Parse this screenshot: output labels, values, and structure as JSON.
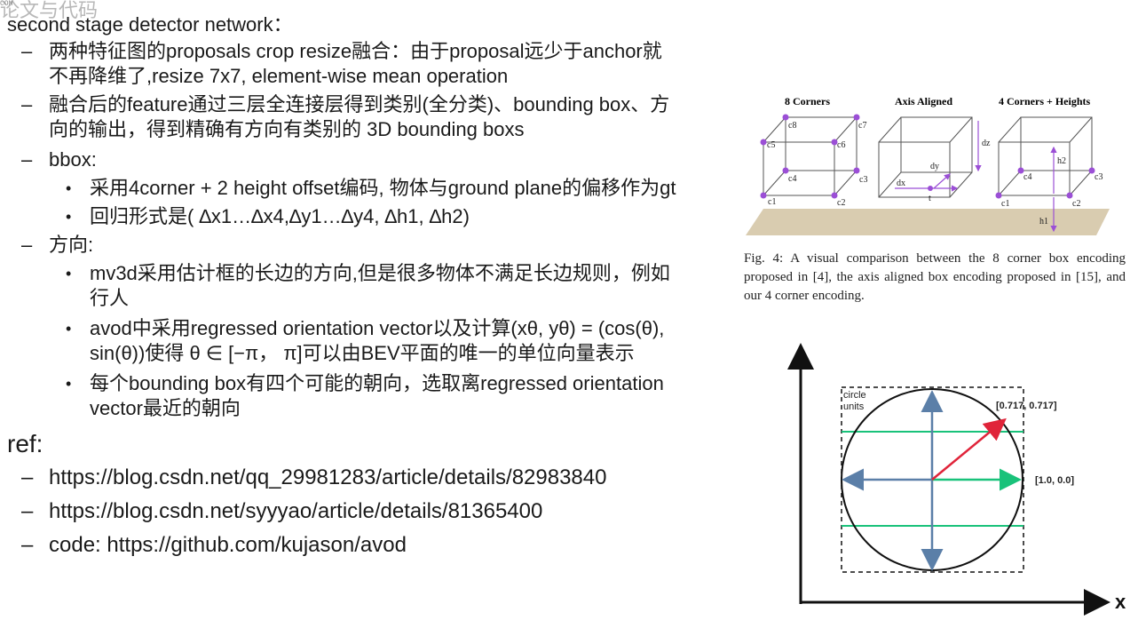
{
  "header": {
    "ghost_text": "论文与代码",
    "corner_mark": "COM",
    "title": "second stage detector network："
  },
  "bullets": [
    {
      "level": 1,
      "lines": [
        "两种特征图的proposals crop resize融合：由于proposal远少于anchor就",
        "不再降维了,resize 7x7, element-wise mean operation"
      ]
    },
    {
      "level": 1,
      "lines": [
        "融合后的feature通过三层全连接层得到类别(全分类)、bounding box、方",
        "向的输出，得到精确有方向有类别的 3D bounding boxs"
      ]
    },
    {
      "level": 1,
      "lines": [
        "bbox:"
      ]
    },
    {
      "level": 2,
      "lines": [
        "采用4corner + 2 height offset编码, 物体与ground plane的偏移作为gt"
      ]
    },
    {
      "level": 2,
      "lines": [
        "回归形式是( ∆x1…∆x4,∆y1…∆y4, ∆h1, ∆h2)"
      ]
    },
    {
      "level": 1,
      "lines": [
        "方向:"
      ]
    },
    {
      "level": 2,
      "lines": [
        "mv3d采用估计框的长边的方向,但是很多物体不满足长边规则，例如",
        "行人"
      ]
    },
    {
      "level": 2,
      "lines": [
        "avod中采用regressed orientation vector以及计算(xθ, yθ) = (cos(θ),",
        "sin(θ))使得 θ ∈ [−π，  π]可以由BEV平面的唯一的单位向量表示"
      ]
    },
    {
      "level": 2,
      "lines": [
        "每个bounding box有四个可能的朝向，选取离regressed orientation",
        "vector最近的朝向"
      ]
    }
  ],
  "ref": {
    "heading": "ref:",
    "items": [
      "https://blog.csdn.net/qq_29981283/article/details/82983840",
      "https://blog.csdn.net/syyyao/article/details/81365400",
      "code: https://github.com/kujason/avod"
    ]
  },
  "markers": {
    "dash": "–",
    "dot": "•"
  },
  "figure": {
    "panels": [
      "8 Corners",
      "Axis Aligned",
      "4 Corners + Heights"
    ],
    "corner_labels": {
      "c1": "c1",
      "c2": "c2",
      "c3": "c3",
      "c4": "c4",
      "c5": "c5",
      "c6": "c6",
      "c7": "c7",
      "c8": "c8"
    },
    "axis_labels": {
      "dz": "dz",
      "dy": "dy",
      "dx": "dx",
      "t": "t"
    },
    "height_labels": {
      "h1": "h1",
      "h2": "h2"
    },
    "caption": "Fig. 4: A visual comparison between the 8 corner box encoding proposed in [4], the axis aligned box encoding proposed in [15], and our 4 corner encoding."
  },
  "orientation_diagram": {
    "circle_label_1": "circle",
    "circle_label_2": "units",
    "diag_point": "[0.717, 0.717]",
    "axis_point": "[1.0, 0.0]",
    "x_axis": "x"
  },
  "colors": {
    "text": "#1a1a1a",
    "corner_dot": "#9b4fd6",
    "green": "#19c27a",
    "red": "#e0243a",
    "blue_arrow": "#5b7fa8",
    "ground": "#d9ccb0"
  }
}
